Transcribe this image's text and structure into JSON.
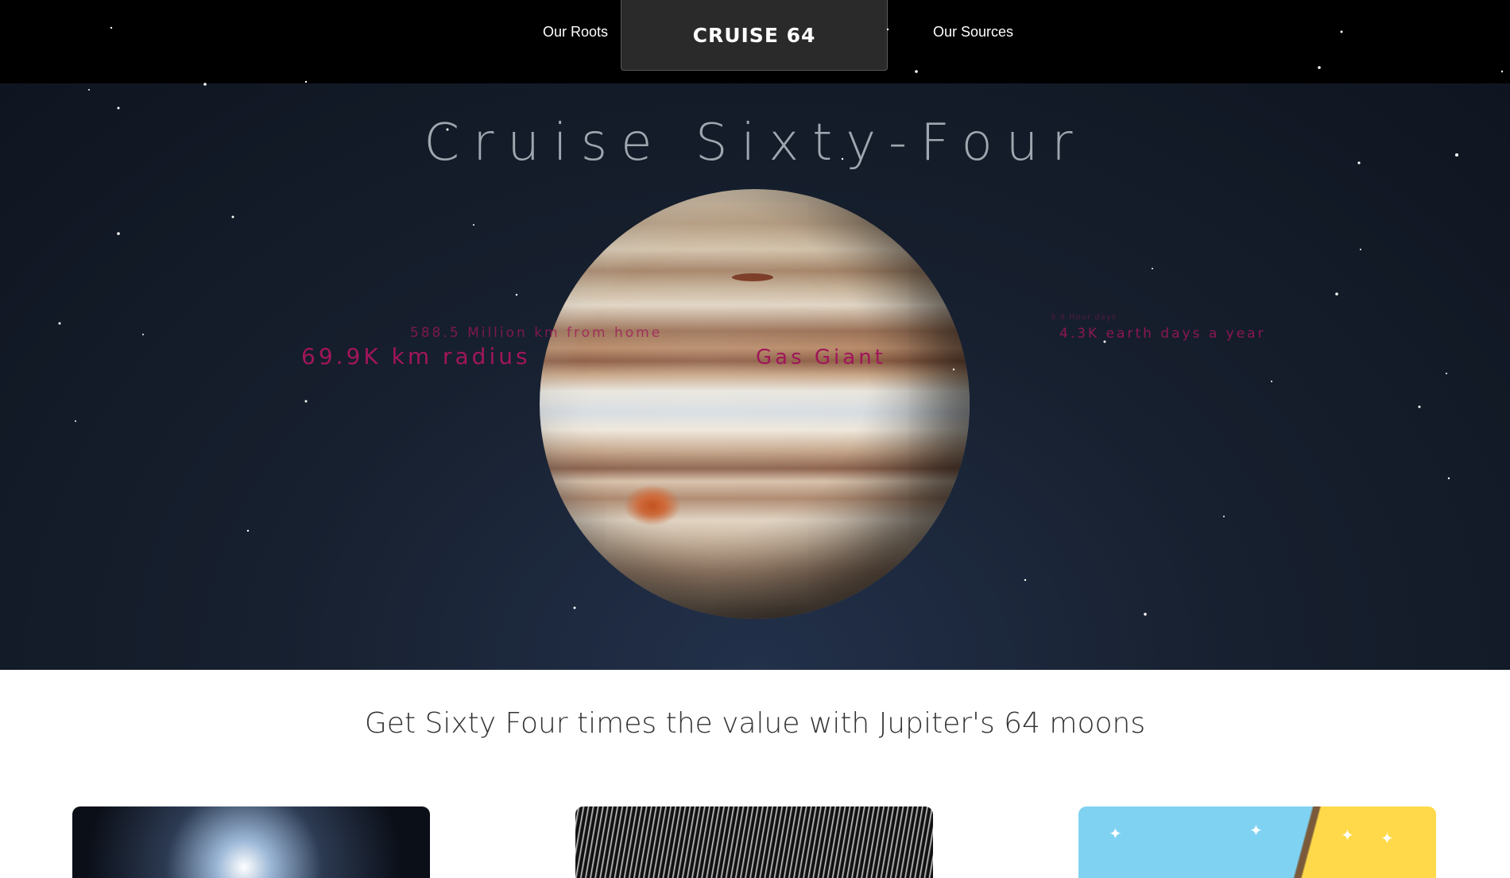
{
  "nav": {
    "left_link": "Our Roots",
    "brand": "CRUISE 64",
    "right_link": "Our Sources"
  },
  "hero": {
    "title": "Cruise Sixty-Four",
    "stats": {
      "radius": "69.9K km radius",
      "distance": "588.5 Million km from home",
      "type": "Gas Giant",
      "year": "4.3K earth days a year",
      "day": "9.9 Hour days"
    }
  },
  "tagline": "Get Sixty Four times the value with Jupiter's 64 moons",
  "cards": [
    {
      "name": "card-space-sunrise"
    },
    {
      "name": "card-hyperspace"
    },
    {
      "name": "card-deals"
    }
  ],
  "colors": {
    "stat_accent": "#a0165a",
    "topbar": "#000000",
    "brand_bg": "#2a2a2a"
  }
}
